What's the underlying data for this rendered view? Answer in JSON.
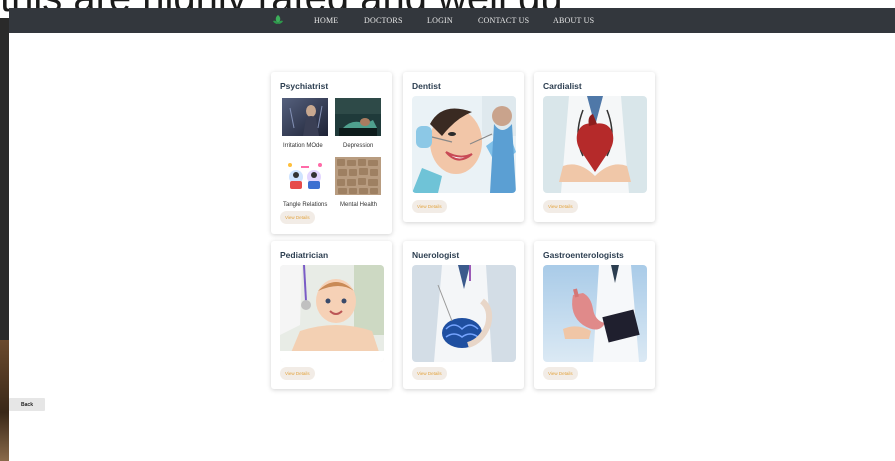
{
  "background": {
    "overlay_text": "this are highly rated and well qu"
  },
  "navbar": {
    "items": [
      {
        "label": "HOME"
      },
      {
        "label": "DOCTORS"
      },
      {
        "label": "LOGIN"
      },
      {
        "label": "CONTACT US"
      },
      {
        "label": "ABOUT US"
      }
    ]
  },
  "cards": {
    "psychiatrist": {
      "title": "Psychiatrist",
      "subitems": [
        {
          "caption": "Irritation MOde"
        },
        {
          "caption": "Depression"
        },
        {
          "caption": "Tangle Relations"
        },
        {
          "caption": "Mental Health"
        }
      ],
      "button": "View Details"
    },
    "dentist": {
      "title": "Dentist",
      "button": "View Details"
    },
    "cardialist": {
      "title": "Cardialist",
      "button": "View Details"
    },
    "pediatrician": {
      "title": "Pediatrician",
      "button": "View Details"
    },
    "neurologist": {
      "title": "Nuerologist",
      "button": "View Details"
    },
    "gastro": {
      "title": "Gastroenterologists",
      "button": "View Details"
    }
  },
  "back_button": "Back",
  "colors": {
    "navbar": "#33373d",
    "button_bg": "#f2ece6",
    "button_text": "#e2a33e",
    "title": "#2c3e50"
  }
}
